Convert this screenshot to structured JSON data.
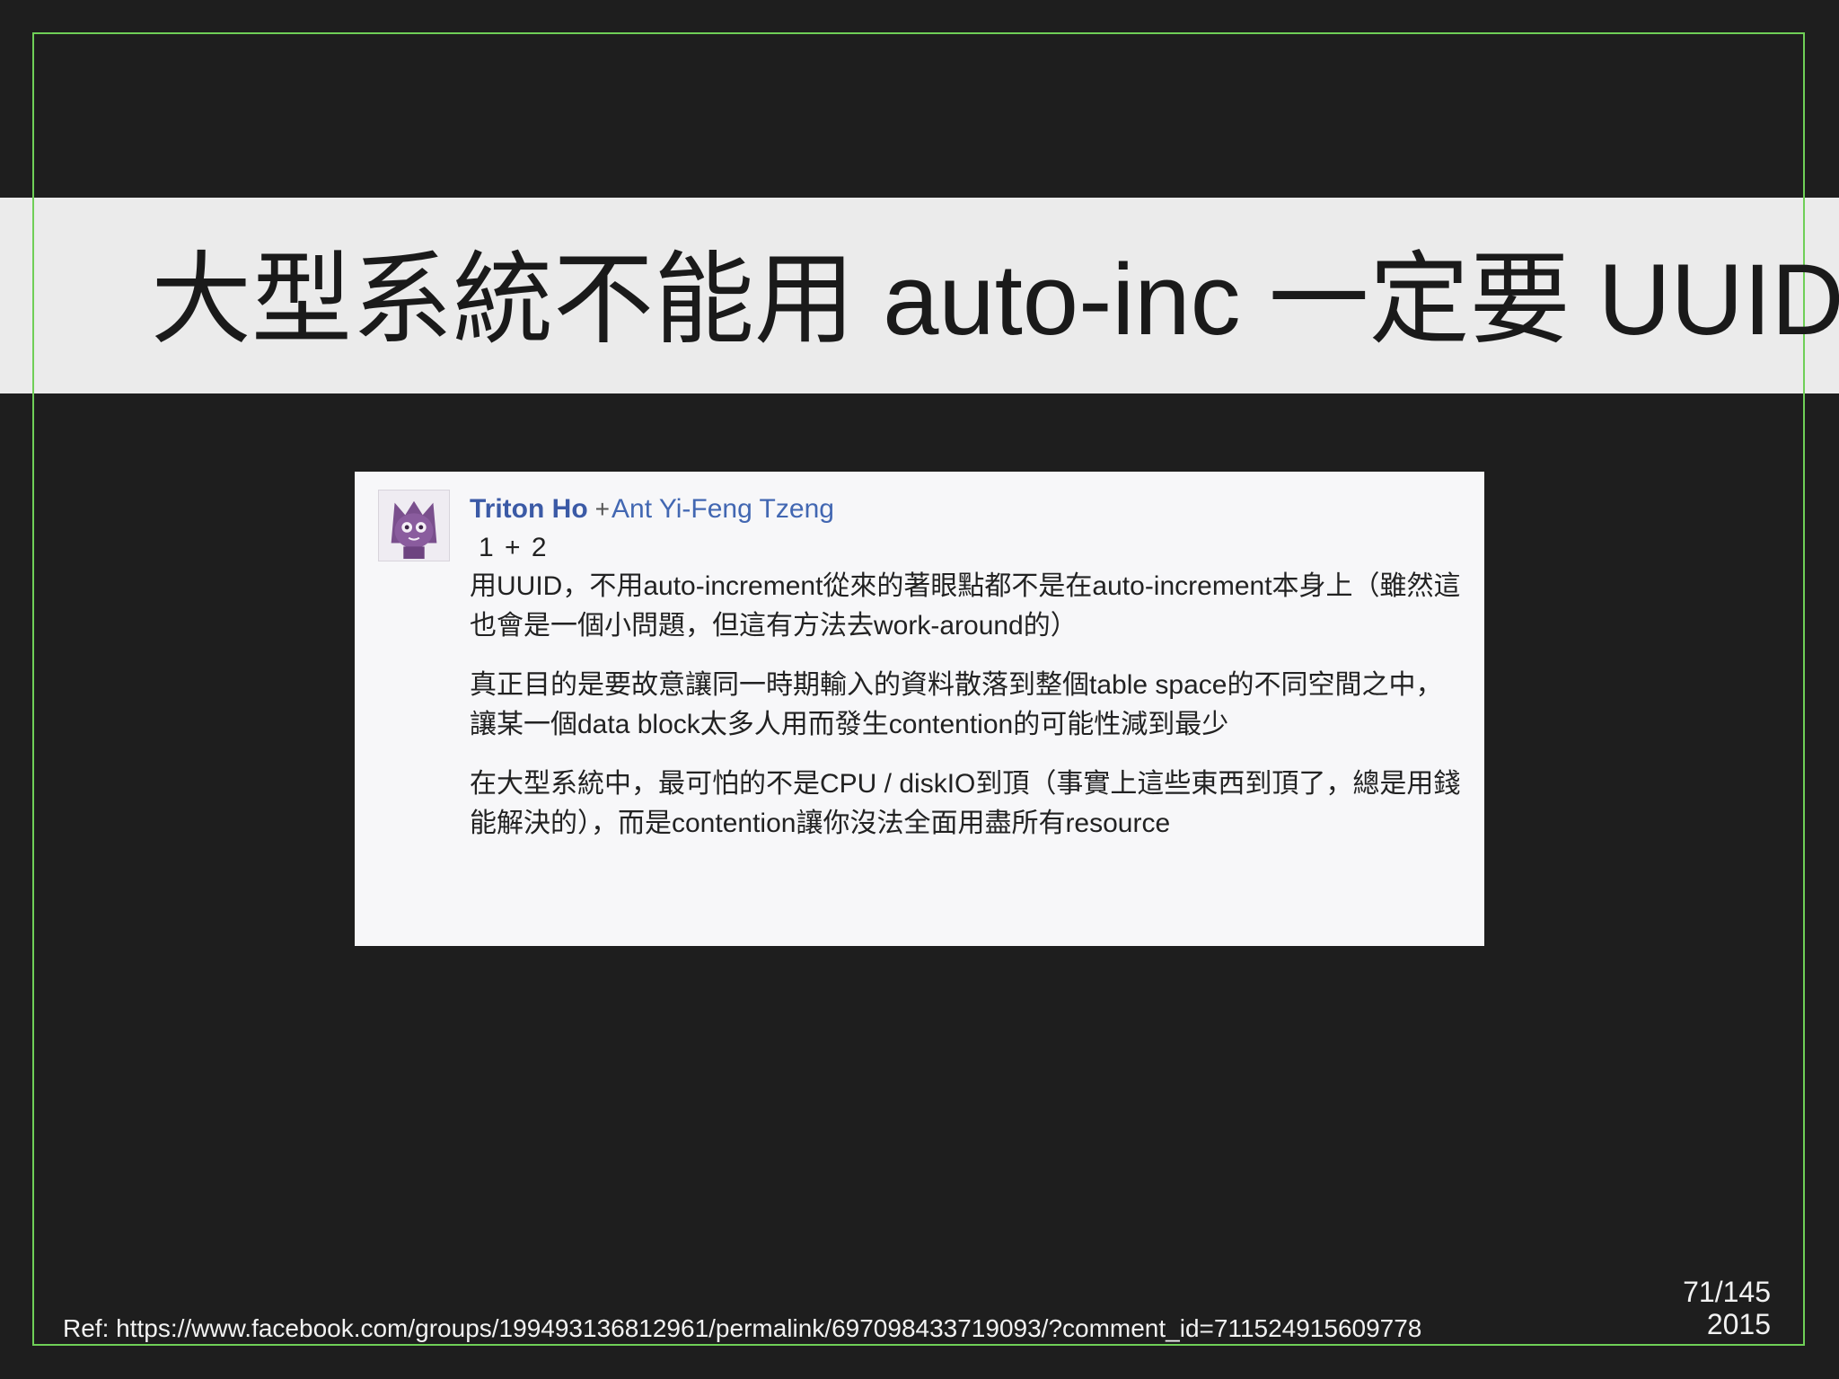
{
  "slide": {
    "title": "大型系統不能用 auto-inc 一定要 UUID",
    "page_number": "71/145",
    "year": "2015",
    "reference": "Ref: https://www.facebook.com/groups/199493136812961/permalink/697098433719093/?comment_id=711524915609778"
  },
  "post": {
    "author": "Triton Ho",
    "plus": "+",
    "mention": "Ant Yi-Feng Tzeng",
    "reply_to": "1 + 2",
    "paragraphs": [
      "用UUID，不用auto-increment從來的著眼點都不是在auto-increment本身上（雖然這也會是一個小問題，但這有方法去work-around的）",
      "真正目的是要故意讓同一時期輸入的資料散落到整個table space的不同空間之中，讓某一個data block太多人用而發生contention的可能性減到最少",
      "在大型系統中，最可怕的不是CPU / diskIO到頂（事實上這些東西到頂了，總是用錢能解決的），而是contention讓你沒法全面用盡所有resource"
    ],
    "avatar_icon": "cat-avatar-icon"
  },
  "colors": {
    "background": "#1e1e1e",
    "frame": "#6fcf57",
    "title_band": "#ebebeb",
    "author": "#3b5aa6",
    "mention": "#4267b2"
  }
}
